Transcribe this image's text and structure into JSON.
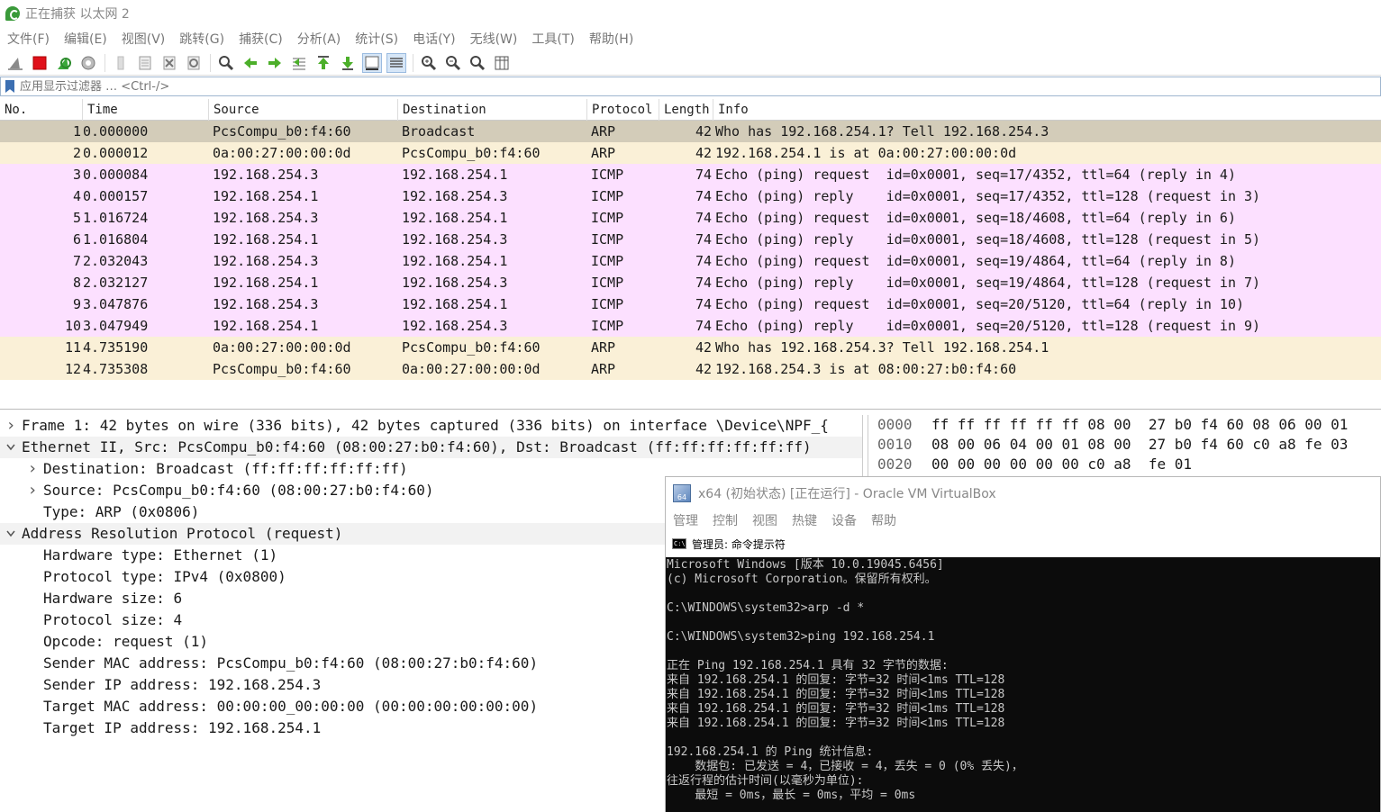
{
  "window": {
    "title": "正在捕获 以太网 2"
  },
  "menu": [
    "文件(F)",
    "编辑(E)",
    "视图(V)",
    "跳转(G)",
    "捕获(C)",
    "分析(A)",
    "统计(S)",
    "电话(Y)",
    "无线(W)",
    "工具(T)",
    "帮助(H)"
  ],
  "toolbar": {
    "icons": [
      "shark-fin-start-icon",
      "stop-capture-icon",
      "restart-capture-icon",
      "capture-options-icon",
      "open-file-icon",
      "save-file-icon",
      "close-file-icon",
      "reload-file-icon",
      "find-packet-icon",
      "go-back-icon",
      "go-forward-icon",
      "go-to-packet-icon",
      "go-first-icon",
      "go-last-icon",
      "auto-scroll-icon",
      "colorize-icon",
      "zoom-in-icon",
      "zoom-out-icon",
      "zoom-normal-icon",
      "resize-columns-icon"
    ]
  },
  "filter": {
    "placeholder": "应用显示过滤器 … <Ctrl-/>"
  },
  "packet_list": {
    "columns": [
      "No.",
      "Time",
      "Source",
      "Destination",
      "Protocol",
      "Length",
      "Info"
    ],
    "rows": [
      {
        "no": "1",
        "time": "0.000000",
        "src": "PcsCompu_b0:f4:60",
        "dst": "Broadcast",
        "proto": "ARP",
        "len": "42",
        "info": "Who has 192.168.254.1? Tell 192.168.254.3",
        "kind": "selected"
      },
      {
        "no": "2",
        "time": "0.000012",
        "src": "0a:00:27:00:00:0d",
        "dst": "PcsCompu_b0:f4:60",
        "proto": "ARP",
        "len": "42",
        "info": "192.168.254.1 is at 0a:00:27:00:00:0d",
        "kind": "arp"
      },
      {
        "no": "3",
        "time": "0.000084",
        "src": "192.168.254.3",
        "dst": "192.168.254.1",
        "proto": "ICMP",
        "len": "74",
        "info": "Echo (ping) request  id=0x0001, seq=17/4352, ttl=64 (reply in 4)",
        "kind": "icmp"
      },
      {
        "no": "4",
        "time": "0.000157",
        "src": "192.168.254.1",
        "dst": "192.168.254.3",
        "proto": "ICMP",
        "len": "74",
        "info": "Echo (ping) reply    id=0x0001, seq=17/4352, ttl=128 (request in 3)",
        "kind": "icmp"
      },
      {
        "no": "5",
        "time": "1.016724",
        "src": "192.168.254.3",
        "dst": "192.168.254.1",
        "proto": "ICMP",
        "len": "74",
        "info": "Echo (ping) request  id=0x0001, seq=18/4608, ttl=64 (reply in 6)",
        "kind": "icmp"
      },
      {
        "no": "6",
        "time": "1.016804",
        "src": "192.168.254.1",
        "dst": "192.168.254.3",
        "proto": "ICMP",
        "len": "74",
        "info": "Echo (ping) reply    id=0x0001, seq=18/4608, ttl=128 (request in 5)",
        "kind": "icmp"
      },
      {
        "no": "7",
        "time": "2.032043",
        "src": "192.168.254.3",
        "dst": "192.168.254.1",
        "proto": "ICMP",
        "len": "74",
        "info": "Echo (ping) request  id=0x0001, seq=19/4864, ttl=64 (reply in 8)",
        "kind": "icmp"
      },
      {
        "no": "8",
        "time": "2.032127",
        "src": "192.168.254.1",
        "dst": "192.168.254.3",
        "proto": "ICMP",
        "len": "74",
        "info": "Echo (ping) reply    id=0x0001, seq=19/4864, ttl=128 (request in 7)",
        "kind": "icmp"
      },
      {
        "no": "9",
        "time": "3.047876",
        "src": "192.168.254.3",
        "dst": "192.168.254.1",
        "proto": "ICMP",
        "len": "74",
        "info": "Echo (ping) request  id=0x0001, seq=20/5120, ttl=64 (reply in 10)",
        "kind": "icmp"
      },
      {
        "no": "10",
        "time": "3.047949",
        "src": "192.168.254.1",
        "dst": "192.168.254.3",
        "proto": "ICMP",
        "len": "74",
        "info": "Echo (ping) reply    id=0x0001, seq=20/5120, ttl=128 (request in 9)",
        "kind": "icmp"
      },
      {
        "no": "11",
        "time": "4.735190",
        "src": "0a:00:27:00:00:0d",
        "dst": "PcsCompu_b0:f4:60",
        "proto": "ARP",
        "len": "42",
        "info": "Who has 192.168.254.3? Tell 192.168.254.1",
        "kind": "arp"
      },
      {
        "no": "12",
        "time": "4.735308",
        "src": "PcsCompu_b0:f4:60",
        "dst": "0a:00:27:00:00:0d",
        "proto": "ARP",
        "len": "42",
        "info": "192.168.254.3 is at 08:00:27:b0:f4:60",
        "kind": "arp"
      }
    ]
  },
  "details": [
    {
      "arrow": "right",
      "level": 0,
      "text": "Frame 1: 42 bytes on wire (336 bits), 42 bytes captured (336 bits) on interface \\Device\\NPF_{"
    },
    {
      "arrow": "down",
      "level": 0,
      "text": "Ethernet II, Src: PcsCompu_b0:f4:60 (08:00:27:b0:f4:60), Dst: Broadcast (ff:ff:ff:ff:ff:ff)",
      "hl": true
    },
    {
      "arrow": "right",
      "level": 1,
      "text": "Destination: Broadcast (ff:ff:ff:ff:ff:ff)"
    },
    {
      "arrow": "right",
      "level": 1,
      "text": "Source: PcsCompu_b0:f4:60 (08:00:27:b0:f4:60)"
    },
    {
      "arrow": "none",
      "level": 1,
      "text": "Type: ARP (0x0806)"
    },
    {
      "arrow": "down",
      "level": 0,
      "text": "Address Resolution Protocol (request)",
      "hl": true
    },
    {
      "arrow": "none",
      "level": 1,
      "text": "Hardware type: Ethernet (1)"
    },
    {
      "arrow": "none",
      "level": 1,
      "text": "Protocol type: IPv4 (0x0800)"
    },
    {
      "arrow": "none",
      "level": 1,
      "text": "Hardware size: 6"
    },
    {
      "arrow": "none",
      "level": 1,
      "text": "Protocol size: 4"
    },
    {
      "arrow": "none",
      "level": 1,
      "text": "Opcode: request (1)"
    },
    {
      "arrow": "none",
      "level": 1,
      "text": "Sender MAC address: PcsCompu_b0:f4:60 (08:00:27:b0:f4:60)"
    },
    {
      "arrow": "none",
      "level": 1,
      "text": "Sender IP address: 192.168.254.3"
    },
    {
      "arrow": "none",
      "level": 1,
      "text": "Target MAC address: 00:00:00_00:00:00 (00:00:00:00:00:00)"
    },
    {
      "arrow": "none",
      "level": 1,
      "text": "Target IP address: 192.168.254.1"
    }
  ],
  "bytes": [
    {
      "offset": "0000",
      "hex": "ff ff ff ff ff ff 08 00  27 b0 f4 60 08 06 00 01"
    },
    {
      "offset": "0010",
      "hex": "08 00 06 04 00 01 08 00  27 b0 f4 60 c0 a8 fe 03"
    },
    {
      "offset": "0020",
      "hex": "00 00 00 00 00 00 c0 a8  fe 01"
    }
  ],
  "vbox": {
    "title": "x64 (初始状态) [正在运行] - Oracle VM VirtualBox",
    "menu": [
      "管理",
      "控制",
      "视图",
      "热键",
      "设备",
      "帮助"
    ],
    "cmd_title": "管理员: 命令提示符",
    "cmd_icon_text": "C:\\",
    "cmd_lines": [
      "Microsoft Windows [版本 10.0.19045.6456]",
      "(c) Microsoft Corporation。保留所有权利。",
      "",
      "C:\\WINDOWS\\system32>arp -d *",
      "",
      "C:\\WINDOWS\\system32>ping 192.168.254.1",
      "",
      "正在 Ping 192.168.254.1 具有 32 字节的数据:",
      "来自 192.168.254.1 的回复: 字节=32 时间<1ms TTL=128",
      "来自 192.168.254.1 的回复: 字节=32 时间<1ms TTL=128",
      "来自 192.168.254.1 的回复: 字节=32 时间<1ms TTL=128",
      "来自 192.168.254.1 的回复: 字节=32 时间<1ms TTL=128",
      "",
      "192.168.254.1 的 Ping 统计信息:",
      "    数据包: 已发送 = 4，已接收 = 4，丢失 = 0 (0% 丢失)，",
      "往返行程的估计时间(以毫秒为单位):",
      "    最短 = 0ms，最长 = 0ms，平均 = 0ms"
    ]
  },
  "colors": {
    "arp_row": "#faf0d7",
    "icmp_row": "#fce0ff",
    "selected_row": "#d3ccb9",
    "cmd_bg": "#0c0c0c"
  }
}
